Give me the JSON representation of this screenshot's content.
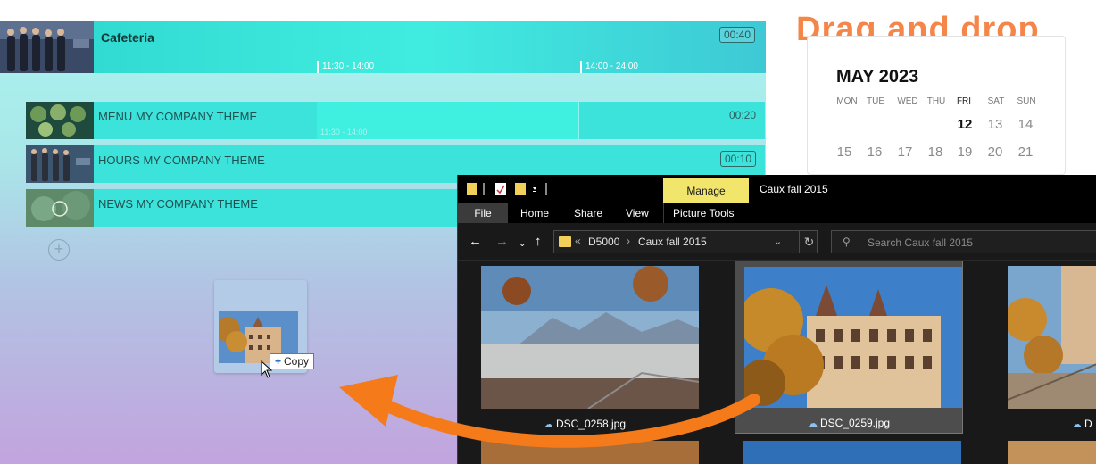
{
  "editor": {
    "cafeteria": {
      "title": "Cafeteria",
      "duration": "00:40",
      "slot1": "11:30 - 14:00",
      "slot2": "14:00 - 24:00"
    },
    "items": [
      {
        "label": "MENU MY COMPANY THEME",
        "duration": "00:20",
        "slot": "11:30 - 14:00"
      },
      {
        "label": "HOURS MY COMPANY THEME",
        "duration": "00:10"
      },
      {
        "label": "NEWS MY COMPANY THEME",
        "duration": ""
      }
    ],
    "add_symbol": "+",
    "copy_tooltip": {
      "plus": "+",
      "label": "Copy"
    }
  },
  "heading": "Drag and drop",
  "calendar": {
    "title": "MAY 2023",
    "weekdays": [
      "MON",
      "TUE",
      "WED",
      "THU",
      "FRI",
      "SAT",
      "SUN"
    ],
    "week1": [
      "12",
      "13",
      "14"
    ],
    "week2": [
      "15",
      "16",
      "17",
      "18",
      "19",
      "20",
      "21"
    ]
  },
  "explorer": {
    "manage_tab": "Manage",
    "window_title": "Caux fall 2015",
    "ribbon_tabs": [
      "File",
      "Home",
      "Share",
      "View",
      "Picture Tools"
    ],
    "address": {
      "overflow": "«",
      "crumb1": "D5000",
      "sep": "›",
      "crumb2": "Caux fall 2015"
    },
    "search_placeholder": "Search Caux fall 2015",
    "files": [
      "DSC_0258.jpg",
      "DSC_0259.jpg",
      "D"
    ]
  },
  "colors": {
    "heading": "#f5864a",
    "arrow": "#f57a1a",
    "manage_tab": "#f2e56c",
    "row": "#3ce3db"
  }
}
